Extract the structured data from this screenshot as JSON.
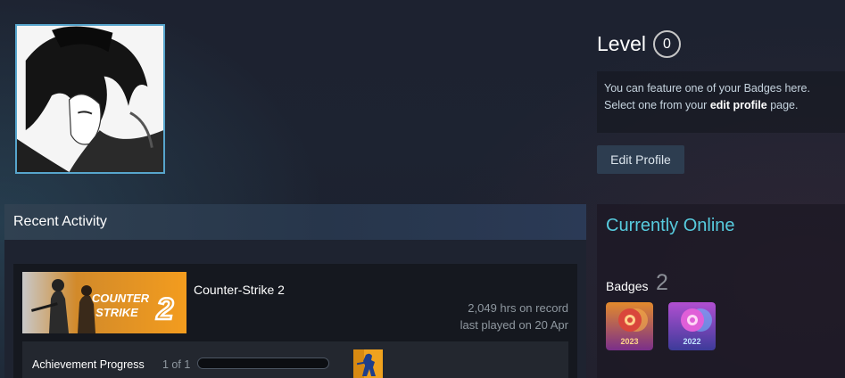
{
  "profile": {
    "level_label": "Level",
    "level_value": "0",
    "badge_tip_prefix": "You can feature one of your Badges here. Select one from your ",
    "badge_tip_link": "edit profile",
    "badge_tip_suffix": " page.",
    "edit_button_label": "Edit Profile"
  },
  "status": {
    "title": "Currently Online",
    "badges_label": "Badges",
    "badges_count": "2",
    "badges": [
      {
        "year": "2023",
        "icon": "steam-badge-2023-icon"
      },
      {
        "year": "2022",
        "icon": "steam-badge-2022-icon"
      }
    ]
  },
  "activity": {
    "title": "Recent Activity",
    "game": {
      "name": "Counter-Strike 2",
      "capsule_text_line1": "COUNTER",
      "capsule_text_line2": "STRIKE",
      "capsule_number": "2",
      "hours": "2,049 hrs on record",
      "last_played": "last played on 20 Apr",
      "achievement_label": "Achievement Progress",
      "achievement_count": "1 of 1",
      "achievement_progress": 0.0
    }
  },
  "colors": {
    "accent_online": "#57cbde",
    "avatar_border": "#57a5cc",
    "capsule_orange": "#f39c1e"
  }
}
